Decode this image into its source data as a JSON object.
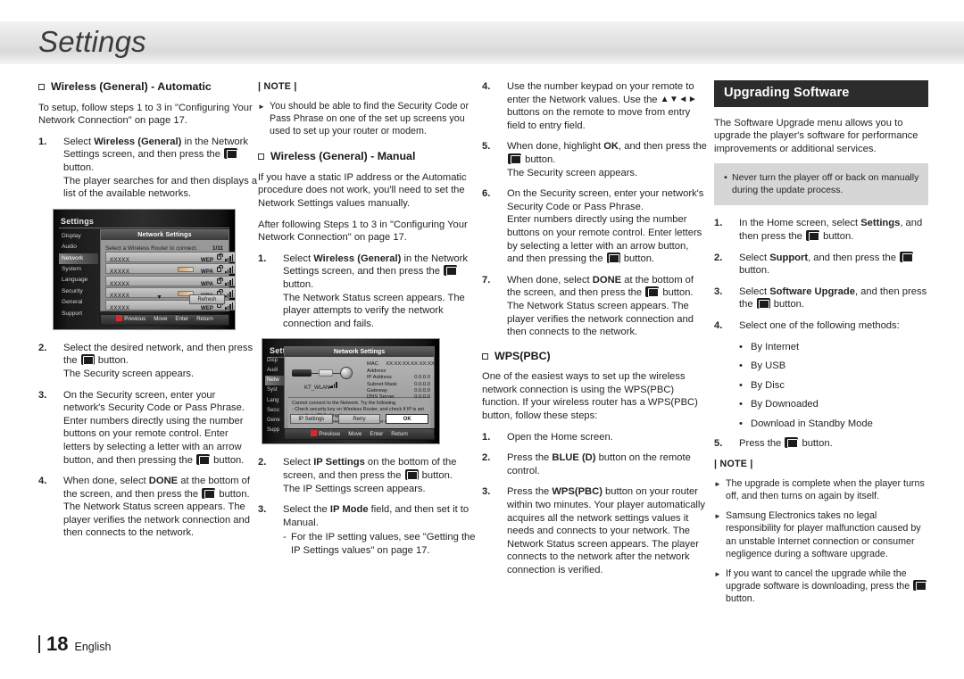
{
  "page": {
    "title": "Settings",
    "number": "18",
    "language": "English"
  },
  "col1": {
    "heading": "Wireless (General) - Automatic",
    "intro": "To setup, follow steps 1 to 3 in \"Configuring Your Network Connection\" on page 17.",
    "steps": [
      {
        "num": "1.",
        "lines": [
          "Select <b>Wireless (General)</b> in the Network Settings screen, and then press the <span class=\"enter-btn\" data-name=\"enter-button-icon\"></span> button.",
          "The player searches for and then displays a list of the available networks."
        ]
      },
      {
        "num": "2.",
        "lines": [
          "Select the desired network, and then press the <span class=\"enter-btn\" data-name=\"enter-button-icon\"></span> button.",
          "The Security screen appears."
        ]
      },
      {
        "num": "3.",
        "lines": [
          "On the Security screen, enter your network's Security Code or Pass Phrase.",
          "Enter numbers directly using the number buttons on your remote control. Enter letters by selecting a letter with an arrow button, and then pressing the <span class=\"enter-btn\" data-name=\"enter-button-icon\"></span> button."
        ]
      },
      {
        "num": "4.",
        "lines": [
          "When done, select <b>DONE</b> at the bottom of the screen, and then press the <span class=\"enter-btn\" data-name=\"enter-button-icon\"></span> button. The Network Status screen appears. The player verifies the network connection and then connects to the network."
        ]
      }
    ]
  },
  "col2": {
    "note_label": "| NOTE |",
    "notes": [
      "You should be able to find the Security Code or Pass Phrase on one of the set up screens you used to set up your router or modem."
    ],
    "heading": "Wireless (General) - Manual",
    "intro1": "If you have a static IP address or the Automatic procedure does not work, you'll need to set the Network Settings values manually.",
    "intro2": "After following Steps 1 to 3 in \"Configuring Your Network Connection\" on page 17.",
    "steps": [
      {
        "num": "1.",
        "lines": [
          "Select <b>Wireless (General)</b> in the Network Settings screen, and then press the <span class=\"enter-btn\" data-name=\"enter-button-icon\"></span> button.",
          "The Network Status screen appears. The player attempts to verify the network connection and fails."
        ]
      },
      {
        "num": "2.",
        "lines": [
          "Select <b>IP Settings</b> on the bottom of the screen, and then press the <span class=\"enter-btn\" data-name=\"enter-button-icon\"></span> button.",
          "The IP Settings screen appears."
        ]
      },
      {
        "num": "3.",
        "lines": [
          "Select the <b>IP Mode</b> field, and then set it to Manual."
        ],
        "sub": "For the IP setting values, see \"Getting the IP Settings values\" on page 17."
      }
    ]
  },
  "col3": {
    "steps": [
      {
        "num": "4.",
        "lines": [
          "Use the number keypad on your remote to enter the Network values. Use the <span class=\"arrows\">▲▼◄►</span> buttons on the remote to move from entry field to entry field."
        ]
      },
      {
        "num": "5.",
        "lines": [
          "When done, highlight <b>OK</b>, and then press the <span class=\"enter-btn\" data-name=\"enter-button-icon\"></span> button.",
          "The Security screen appears."
        ]
      },
      {
        "num": "6.",
        "lines": [
          "On the Security screen, enter your network's Security Code or Pass Phrase.",
          "Enter numbers directly using the number buttons on your remote control. Enter letters by selecting a letter with an arrow button, and then pressing the <span class=\"enter-btn\" data-name=\"enter-button-icon\"></span> button."
        ]
      },
      {
        "num": "7.",
        "lines": [
          "When done, select <b>DONE</b> at the bottom of the screen, and then press the <span class=\"enter-btn\" data-name=\"enter-button-icon\"></span> button. The Network Status screen appears. The player verifies the network connection and then connects to the network."
        ]
      }
    ],
    "heading": "WPS(PBC)",
    "intro": "One of the easiest ways to set up the wireless network connection is using the WPS(PBC) function. If your wireless router has a WPS(PBC) button, follow these steps:",
    "steps2": [
      {
        "num": "1.",
        "lines": [
          "Open the Home screen."
        ]
      },
      {
        "num": "2.",
        "lines": [
          "Press the <b>BLUE (D)</b> button on the remote control."
        ]
      },
      {
        "num": "3.",
        "lines": [
          "Press the <b>WPS(PBC)</b> button on your router within two minutes. Your player automatically acquires all the network settings values it needs and connects to your network. The Network Status screen appears. The player connects to the network after the network connection is verified."
        ]
      }
    ]
  },
  "col4": {
    "bar_heading": "Upgrading Software",
    "intro": "The Software Upgrade menu allows you to upgrade the player's software for performance improvements or additional services.",
    "caution": "Never turn the player off or back on manually during the update process.",
    "steps": [
      {
        "num": "1.",
        "lines": [
          "In the Home screen, select <b>Settings</b>, and then press the <span class=\"enter-btn\" data-name=\"enter-button-icon\"></span> button."
        ]
      },
      {
        "num": "2.",
        "lines": [
          "Select <b>Support</b>, and then press the <span class=\"enter-btn\" data-name=\"enter-button-icon\"></span> button."
        ]
      },
      {
        "num": "3.",
        "lines": [
          "Select <b>Software Upgrade</b>, and then press the <span class=\"enter-btn\" data-name=\"enter-button-icon\"></span> button."
        ]
      },
      {
        "num": "4.",
        "lines": [
          "Select one of the following methods:"
        ]
      }
    ],
    "methods": [
      "By Internet",
      "By USB",
      "By Disc",
      "By Downoaded",
      "Download in Standby Mode"
    ],
    "step5": {
      "num": "5.",
      "lines": [
        "Press the <span class=\"enter-btn\" data-name=\"enter-button-icon\"></span> button."
      ]
    },
    "note_label": "| NOTE |",
    "notes": [
      "The upgrade is complete when the player turns off, and then turns on again by itself.",
      "Samsung Electronics takes no legal responsibility for player malfunction caused by an unstable Internet connection or consumer negligence during a software upgrade.",
      "If you want to cancel the upgrade while the upgrade software is downloading, press the <span class=\"enter-btn\" data-name=\"enter-button-icon\"></span> button."
    ]
  },
  "tv1": {
    "brand": "Settings",
    "sidebar": [
      "Display",
      "Audio",
      "Network",
      "System",
      "Language",
      "Security",
      "General",
      "Support"
    ],
    "active": "Network",
    "panel_title": "Network Settings",
    "subtitle": "Select a Wireless Router to connect.",
    "count": "1/11",
    "rows": [
      {
        "ssid": "XXXXX",
        "sec": "WEP",
        "dots": false
      },
      {
        "ssid": "XXXXX",
        "sec": "WPA",
        "dots": true
      },
      {
        "ssid": "XXXXX",
        "sec": "WPA",
        "dots": false
      },
      {
        "ssid": "XXXXX",
        "sec": "WPA",
        "dots": true
      },
      {
        "ssid": "XXXXX",
        "sec": "WEP",
        "dots": false
      }
    ],
    "refresh": "Refresh",
    "footer": [
      "Previous",
      "Move",
      "Enter",
      "Return"
    ]
  },
  "tv2": {
    "brand": "Settings",
    "sidebar": [
      "Disp",
      "Audi",
      "Netw",
      "Syst",
      "Lang",
      "Secu",
      "Gene",
      "Supp"
    ],
    "active": "Netw",
    "panel_title": "Network Settings",
    "ssid": "KT_WLAN",
    "info": [
      {
        "label": "MAC Address",
        "value": "XX:XX:XX:XX:XX:XX"
      },
      {
        "label": "IP Address",
        "value": "0.0.0.0"
      },
      {
        "label": "Subnet Mask",
        "value": "0.0.0.0"
      },
      {
        "label": "Gateway",
        "value": "0.0.0.0"
      },
      {
        "label": "DNS Server",
        "value": "0.0.0.0"
      }
    ],
    "message_lines": [
      "Cannot connect to the Network. Try the following.",
      "- Check security key on Wireless Router, and check if IP is set correctly in 'IP Settings'.",
      "- Contact your Internet Service Provider for more information."
    ],
    "buttons": [
      "IP Settings",
      "Retry",
      "OK"
    ],
    "selected_button": "OK",
    "footer": [
      "Previous",
      "Move",
      "Enter",
      "Return"
    ]
  }
}
